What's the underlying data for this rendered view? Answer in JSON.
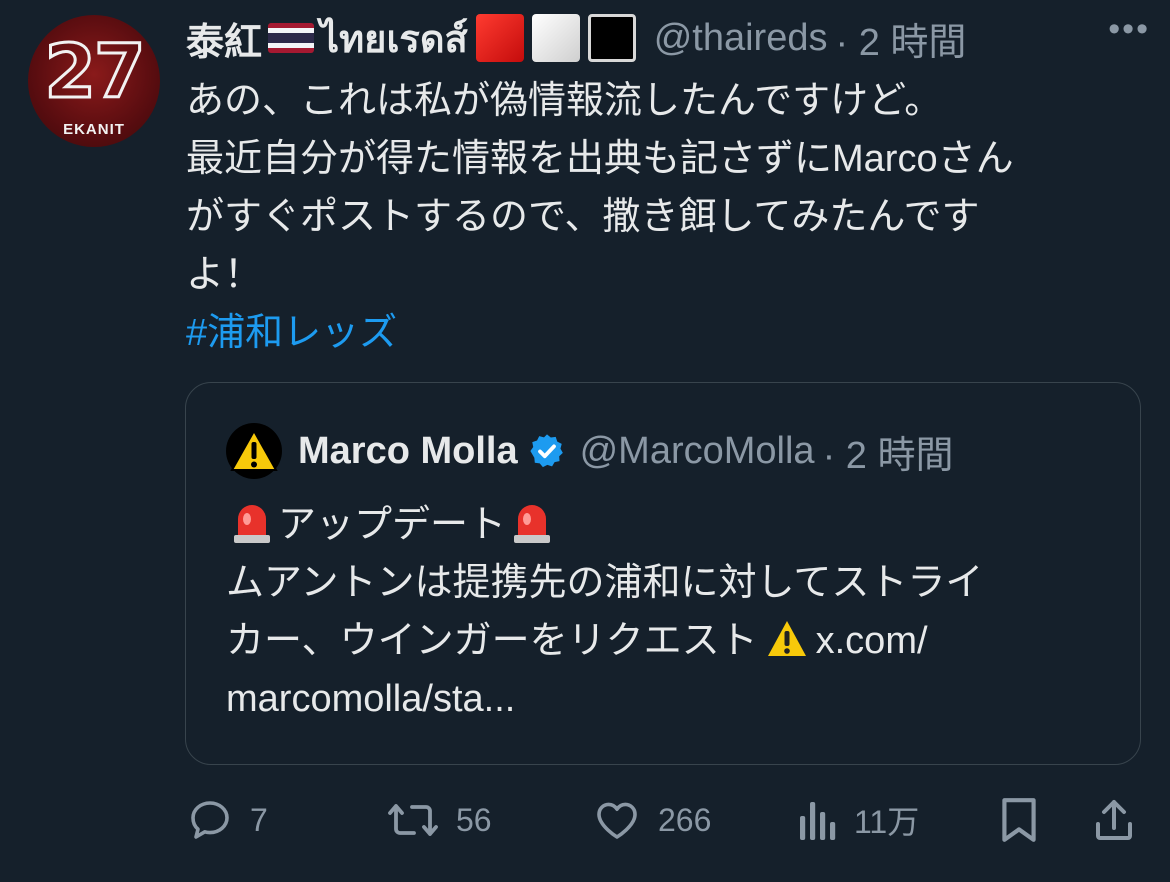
{
  "tweet": {
    "author_name": "泰紅",
    "author_name_thai": "ไทยเรดส์",
    "handle": "@thaireds",
    "time": "· 2 時間",
    "more": "•••",
    "avatar": {
      "number": "27",
      "name": "EKANIT"
    },
    "text_lines": [
      "あの、これは私が偽情報流したんですけど。",
      "最近自分が得た情報を出典も記さずにMarcoさん",
      "がすぐポストするので、撒き餌してみたんです",
      "よ！"
    ],
    "hashtag": "#浦和レッズ"
  },
  "quoted": {
    "name": "Marco Molla",
    "handle": "@MarcoMolla",
    "time": "· 2 時間",
    "line1": "アップデート",
    "line2": "ムアントンは提携先の浦和に対してストライ",
    "line3": "カー、ウインガーをリクエスト",
    "line3_link": "x.com/",
    "line4": "marcomolla/sta..."
  },
  "actions": {
    "reply_count": "7",
    "repost_count": "56",
    "like_count": "266",
    "views_count": "11万"
  },
  "icons": [
    "thai-flag-icon",
    "red-square-icon",
    "white-square-icon",
    "black-square-icon",
    "more-icon",
    "warning-icon",
    "verified-icon",
    "siren-icon",
    "reply-icon",
    "repost-icon",
    "like-icon",
    "views-icon",
    "bookmark-icon",
    "share-icon"
  ],
  "colors": {
    "background": "#15202b",
    "text": "#e7e9ea",
    "muted": "#8b98a5",
    "link": "#1d9bf0",
    "border": "#38444d",
    "verified": "#1d9bf0"
  }
}
